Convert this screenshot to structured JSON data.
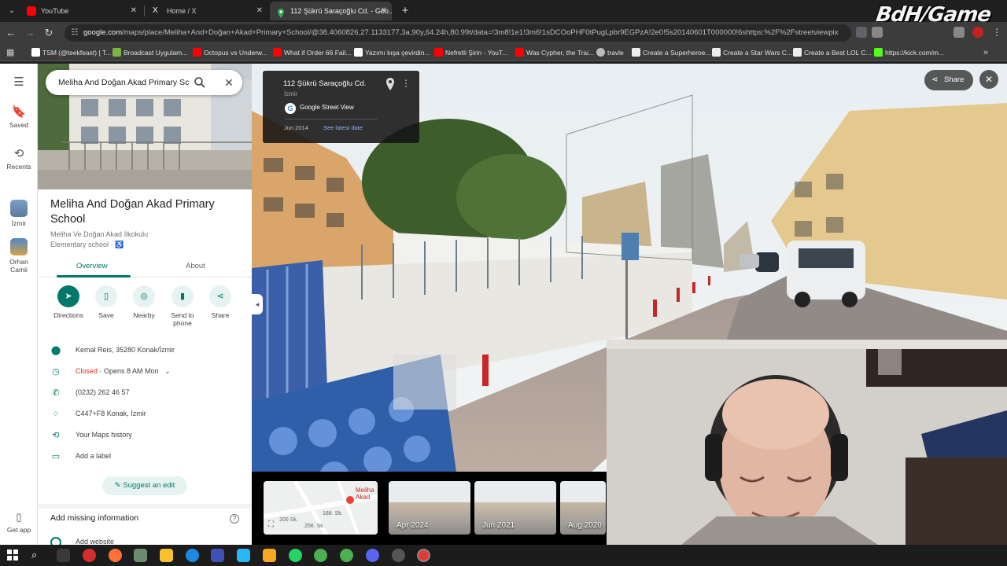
{
  "browser": {
    "tabs": [
      {
        "title": "YouTube",
        "icon": "youtube-icon",
        "icon_color": "#ff0000"
      },
      {
        "title": "Home / X",
        "icon": "x-icon",
        "icon_color": "#ffffff"
      },
      {
        "title": "112 Şükrü Saraçoğlu Cd. - Goo...",
        "icon": "maps-icon",
        "icon_color": "#34a853"
      }
    ],
    "url_domain": "google.com",
    "url_path": "/maps/place/Meliha+And+Doğan+Akad+Primary+School/@38.4060826,27.1133177,3a,90y,64.24h,80.99t/data=!3m8!1e1!3m6!1sDCOoPHF0tPugLpbr9EGPzA!2e0!5s20140601T000000!6shttps:%2F%2Fstreetviewpixels-pa...",
    "bookmarks": [
      {
        "label": "TSM (@teekfeast) | T...",
        "color": "#ffffff"
      },
      {
        "label": "Broadcast Uygulam...",
        "color": "#7cb342"
      },
      {
        "label": "Octopus vs Underw...",
        "color": "#ff0000"
      },
      {
        "label": "What if Order 66 Fail...",
        "color": "#ff0000"
      },
      {
        "label": "Yazımı kışa çevirdin...",
        "color": "#ffffff"
      },
      {
        "label": "Nefretli Şirin - YouT...",
        "color": "#ff0000"
      },
      {
        "label": "Was Cypher, the Trai...",
        "color": "#ff0000"
      },
      {
        "label": "travle",
        "color": "#bbbbbb"
      },
      {
        "label": "Create a Superheroe...",
        "color": "#ffffff"
      },
      {
        "label": "Create a Star Wars C...",
        "color": "#ffffff"
      },
      {
        "label": "Create a Best LOL C...",
        "color": "#ffffff"
      },
      {
        "label": "https://kick.com/m...",
        "color": "#53fc18"
      }
    ]
  },
  "rail": {
    "saved": "Saved",
    "recents": "Recents",
    "recent1": "İzmir",
    "recent2": "Orhan Camii",
    "get_app": "Get app"
  },
  "search": {
    "query": "Meliha And Doğan Akad Primary School"
  },
  "place": {
    "title": "Meliha And Doğan Akad Primary School",
    "local_name": "Meliha Ve Doğan Akad İlkokulu",
    "type": "Elementary school · ♿",
    "tabs": [
      "Overview",
      "About"
    ],
    "actions": [
      "Directions",
      "Save",
      "Nearby",
      "Send to phone",
      "Share"
    ],
    "address": "Kemal Reis, 35280 Konak/İzmir",
    "hours_status": "Closed",
    "hours_detail": " · Opens 8 AM Mon",
    "phone": "(0232) 262 46 57",
    "plus_code": "C447+F8 Konak, İzmir",
    "history": "Your Maps history",
    "label": "Add a label",
    "suggest": "Suggest an edit",
    "missing": "Add missing information",
    "add_website": "Add website"
  },
  "streetview": {
    "address": "112 Şükrü Saraçoğlu Cd.",
    "city": "İzmir",
    "provider": "Google Street View",
    "date": "Jun 2014",
    "latest": "See latest date",
    "share": "Share",
    "street_sign": "Sk.",
    "map_labels": [
      "Meliha Akad",
      "188. Sk.",
      "256. Sk.",
      "200 Sk."
    ],
    "thumbnails": [
      "Apr 2024",
      "Jun 2021",
      "Aug 2020"
    ]
  },
  "watermark": "BdH/Game",
  "colors": {
    "accent": "#00796b",
    "closed": "#d93025",
    "link": "#8ab4f8"
  }
}
